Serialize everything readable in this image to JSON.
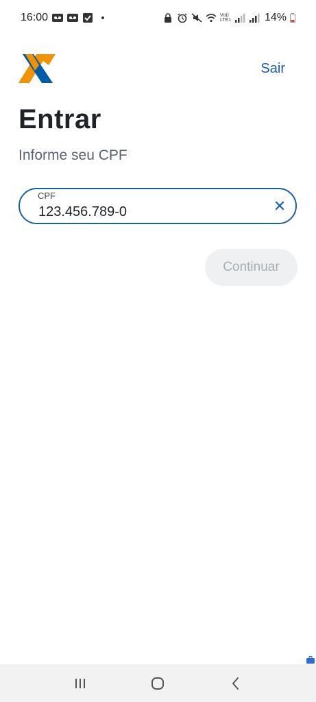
{
  "status_bar": {
    "time": "16:00",
    "battery": "14%",
    "left_icons": [
      "voicemail-icon",
      "voicemail-icon",
      "checkbox-icon"
    ],
    "right_icons": [
      "lock-icon",
      "alarm-icon",
      "mute-icon",
      "wifi-icon",
      "volte-icon",
      "signal-icon",
      "signal-icon",
      "battery-icon"
    ],
    "volte_label": "Vo)) LTE1"
  },
  "header": {
    "logo_icon": "caixa-logo-icon",
    "exit_label": "Sair"
  },
  "page": {
    "title": "Entrar",
    "subtitle": "Informe seu CPF"
  },
  "cpf_field": {
    "label": "CPF",
    "value": "123.456.789-0",
    "clear_icon": "close-icon"
  },
  "continue_button": {
    "label": "Continuar",
    "enabled": false
  },
  "nav_bar": {
    "icons": [
      "recents-icon",
      "home-icon",
      "back-icon"
    ]
  },
  "colors": {
    "primary": "#1b5ea8",
    "logo_orange": "#f39200",
    "logo_blue": "#005ca9",
    "disabled_bg": "#eef0f1",
    "disabled_text": "#a7adb2"
  }
}
